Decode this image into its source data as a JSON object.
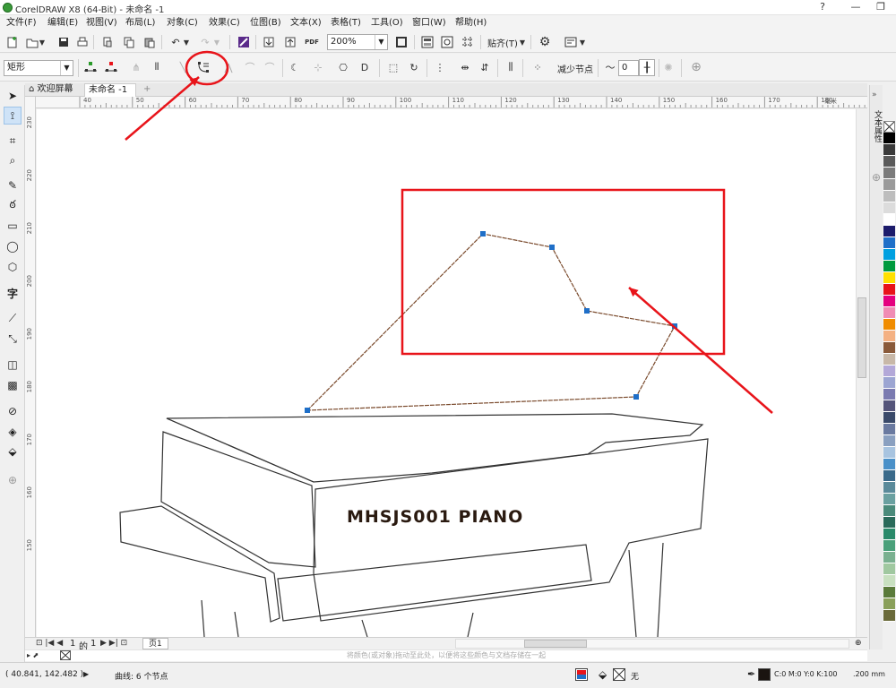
{
  "window": {
    "title": "CorelDRAW X8 (64-Bit) - 未命名 -1",
    "controls": [
      "?",
      "—",
      "❐"
    ]
  },
  "menu": [
    "文件(F)",
    "编辑(E)",
    "视图(V)",
    "布局(L)",
    "对象(C)",
    "效果(C)",
    "位图(B)",
    "文本(X)",
    "表格(T)",
    "工具(O)",
    "窗口(W)",
    "帮助(H)"
  ],
  "standard_toolbar": {
    "zoom_value": "200%",
    "pdf_label": "PDF",
    "snap_label": "贴齐(T)"
  },
  "property_bar": {
    "selection_mode": "矩形",
    "reduce_nodes_label": "减少节点",
    "smoothness_value": "0"
  },
  "tabs": {
    "welcome": "欢迎屏幕",
    "document": "未命名 -1",
    "add": "+"
  },
  "rulers": {
    "horizontal": [
      "40",
      "50",
      "60",
      "70",
      "80",
      "90",
      "100",
      "110",
      "120",
      "130",
      "140",
      "150",
      "160",
      "170",
      "180"
    ],
    "vertical": [
      "230",
      "220",
      "210",
      "200",
      "190",
      "180",
      "170",
      "160",
      "150"
    ],
    "unit": "毫米"
  },
  "canvas": {
    "piano_text": "MHSJS001 PIANO",
    "curve_color": "#7a4a2c",
    "annotation_color": "#e8141a",
    "node_color": "#1f6fc8"
  },
  "page_nav": {
    "current": "1",
    "of_label": "的",
    "total": "1",
    "page_tab": "页1"
  },
  "hint_text": "将颜色(或对象)拖动至此处，以便将这些颜色与文档存储在一起",
  "status": {
    "coordinates": "( 40.841, 142.482 )",
    "object_info": "曲线: 6 个节点",
    "fill_none": "无",
    "outline_color": "C:0 M:0 Y:0 K:100",
    "outline_width": ".200 mm"
  },
  "docker": {
    "title": "文本属性"
  },
  "palette": [
    "#ffffff",
    "#000000",
    "#3a3a3a",
    "#5a5a5a",
    "#7a7a7a",
    "#9a9a9a",
    "#bdbdbd",
    "#dcdcdc",
    "#ffffff",
    "#1c1b6b",
    "#1f6fc8",
    "#00a0e0",
    "#009a3e",
    "#ffe000",
    "#e8141a",
    "#e4007f",
    "#f08cb4",
    "#f08c00",
    "#f4b183",
    "#8a5a3a",
    "#c8b8a8",
    "#b3a8d8",
    "#9ca5d2",
    "#7a7ab0",
    "#55557a",
    "#3a4a6a",
    "#6a7aa0",
    "#8aa0c0",
    "#a8c4e0",
    "#4a90c8",
    "#3a6a8a",
    "#5a8a9a",
    "#6aa0a0",
    "#4a8a7a",
    "#2a6a5a",
    "#2a8a6a",
    "#4aa07a",
    "#7ab090",
    "#a0c8a0",
    "#c8e0c0",
    "#5a7a3a",
    "#8aa05a",
    "#6a6a3a"
  ]
}
